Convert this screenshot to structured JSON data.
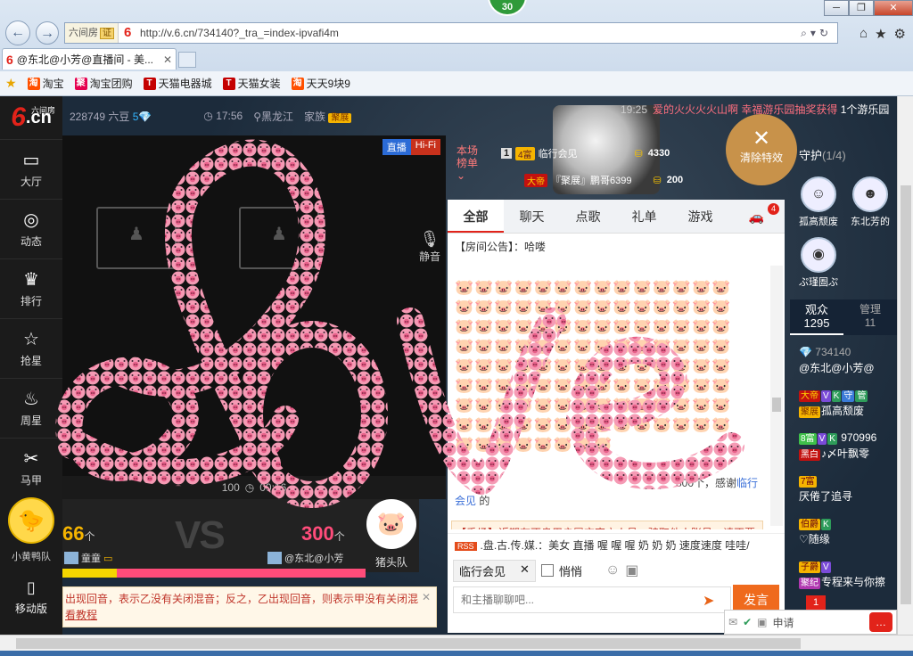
{
  "browser": {
    "counter": "30",
    "addr_tag": "六间房",
    "addr_tag2": "证",
    "url": "http://v.6.cn/734140?_tra_=index-ipvafi4m",
    "tab_title": "@东北@小芳@直播间 - 美...",
    "favorites": [
      {
        "icon": "淘",
        "label": "淘宝",
        "type": "tb"
      },
      {
        "icon": "聚",
        "label": "淘宝团购",
        "type": "ju"
      },
      {
        "icon": "T",
        "label": "天猫电器城",
        "type": "tm"
      },
      {
        "icon": "T",
        "label": "天猫女装",
        "type": "tm"
      },
      {
        "icon": "淘",
        "label": "天天9块9",
        "type": "tb"
      }
    ]
  },
  "sidebar": {
    "logo_six": "6",
    "logo_cn": ".cn",
    "logo_small": "六间房",
    "items": [
      {
        "icon": "▭",
        "label": "大厅"
      },
      {
        "icon": "◎",
        "label": "动态"
      },
      {
        "icon": "♛",
        "label": "排行"
      },
      {
        "icon": "☆",
        "label": "抢星"
      },
      {
        "icon": "♨",
        "label": "周星"
      },
      {
        "icon": "✂",
        "label": "马甲"
      }
    ],
    "duck_label": "小黄鸭队",
    "mobile_label": "移动版"
  },
  "info_bar": {
    "beans": "228749 六豆",
    "level": "5",
    "time": "17:56",
    "location": "黑龙江",
    "family_label": "家族",
    "family_tag": "聚展"
  },
  "player": {
    "tag_live": "直播",
    "tag_hifi": "Hi-Fi",
    "mic_label": "静音",
    "volume": "100",
    "elapsed": "00:16"
  },
  "pk": {
    "left_score": "66",
    "unit": "个",
    "vs": "VS",
    "right_score": "300",
    "left_user": "童童",
    "right_user": "@东北@小芳",
    "left_fraction": 0.18,
    "pig_team": "猪头队"
  },
  "notice": {
    "text": "出现回音，表示乙没有关闭混音；反之，乙出现回音，则表示甲没有关闭混",
    "link": "看教程"
  },
  "host": {
    "marquee_time": "19:25",
    "marquee_text": "爱的火火火火山啊 幸福游乐园抽奖获得",
    "marquee_rest": "1个游乐园",
    "rank_label_1": "本场",
    "rank_label_2": "榜单",
    "rank_rows": [
      {
        "num": "1",
        "badge": "4富",
        "badge_type": "gold",
        "name": "临行会见",
        "value": "4330"
      },
      {
        "num": "",
        "badge": "大帝",
        "badge_type": "red",
        "name": "『聚展』鹏哥6399",
        "value": "200"
      }
    ],
    "clear_effect": "清除特效"
  },
  "chat": {
    "tabs": [
      "全部",
      "聊天",
      "点歌",
      "礼单",
      "游戏",
      "🚗"
    ],
    "car_count": "4",
    "announce": "【房间公告】：哈喽",
    "pig_rows": "🐷🐷🐷🐷🐷🐷🐷🐷🐷🐷🐷🐷🐷🐷🐷🐷🐷🐷🐷🐷🐷🐷🐷🐷🐷🐷🐷🐷🐷🐷🐷🐷🐷🐷🐷🐷🐷🐷🐷🐷🐷🐷🐷🐷🐷🐷🐷🐷🐷🐷🐷🐷🐷🐷🐷🐷🐷🐷🐷🐷🐷🐷🐷🐷🐷🐷🐷🐷🐷🐷🐷🐷🐷🐷🐷🐷🐷🐷🐷🐷🐷🐷🐷🐷🐷🐷🐷🐷🐷🐷🐷🐷🐷🐷🐷🐷🐷🐷🐷🐷🐷🐷🐷🐷🐷🐷🐷🐷🐷🐷🐷🐷🐷🐷🐷🐷🐷🐷🐷🐷",
    "thanks_count": "300个，感谢",
    "thanks_name": "临行",
    "thanks_name2": "会见",
    "thanks_rest": "的",
    "safety": "【秀场】近期有不良用户冒充官方人员，骗取他人账号，请不要随意让他人登陆您的账号，以免您的账号被盗！",
    "ticker_rss": "RSS",
    "ticker": ".盘.古.传.媒.：美女 直播 喔 喔 喔 奶 奶 奶 速度速度 哇哇/",
    "target_user": "临行会见",
    "quiet_label": "悄悄",
    "input_placeholder": "和主播聊聊吧...",
    "send": "发言"
  },
  "right": {
    "guard_title": "守护",
    "guard_count": "(1/4)",
    "guards": [
      {
        "name": "孤高颓废",
        "icon": "☺"
      },
      {
        "name": "东北芳的",
        "icon": "☻"
      },
      {
        "name": "ぷ瑾圄ぷ",
        "icon": "◉"
      }
    ],
    "aud_tab": "观众",
    "aud_count": "1295",
    "mgr_tab": "管理",
    "mgr_count": "11",
    "host_id": "734140",
    "host_name": "@东北@小芳@",
    "audience": [
      {
        "badges": [
          [
            "大帝",
            "red"
          ],
          [
            "V",
            "v"
          ],
          [
            "K",
            "k"
          ],
          [
            "守",
            "guard"
          ],
          [
            "管",
            "mgr"
          ]
        ],
        "badges2": [
          [
            "聚展",
            "fam"
          ]
        ],
        "name": "孤高颓废"
      },
      {
        "badges": [
          [
            "8富",
            "green"
          ],
          [
            "V",
            "v"
          ],
          [
            "K",
            "k"
          ]
        ],
        "extra": "970996",
        "badges2": [
          [
            "黑白",
            "black"
          ]
        ],
        "name": "♪〆叶飘零"
      },
      {
        "badges": [
          [
            "7富",
            "gold"
          ]
        ],
        "name": "厌倦了追寻"
      },
      {
        "badges": [
          [
            "伯爵",
            "gold"
          ],
          [
            "K",
            "k"
          ]
        ],
        "name": "♡随缘"
      },
      {
        "badges": [
          [
            "子爵",
            "gold"
          ],
          [
            "V",
            "v"
          ]
        ],
        "badges2": [
          [
            "聚纪",
            "purple"
          ]
        ],
        "name": "专程来与你擦"
      }
    ],
    "msg_count": "1",
    "msg_apply": "申请"
  }
}
